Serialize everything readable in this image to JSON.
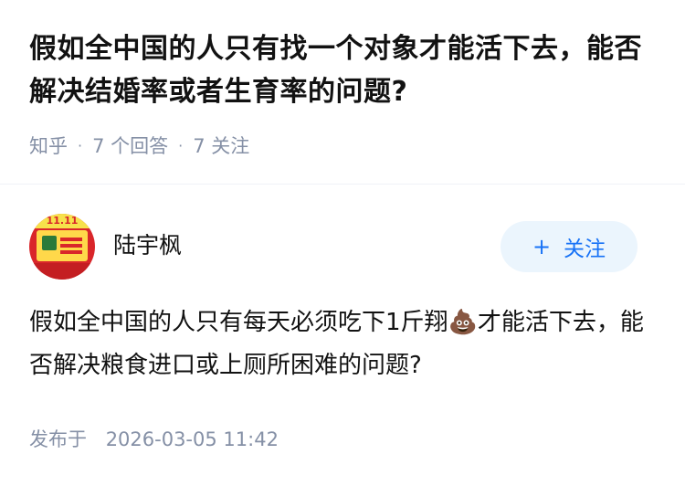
{
  "question": {
    "title": "假如全中国的人只有找一个对象才能活下去，能否解决结婚率或者生育率的问题?",
    "source": "知乎",
    "separator": "·",
    "answer_count": "7 个回答",
    "follow_count": "7 关注"
  },
  "author": {
    "avatar_text": "11.11",
    "name": "陆宇枫",
    "follow_plus": "+",
    "follow_label": "关注"
  },
  "answer": {
    "text_before": "假如全中国的人只有每天必须吃下1斤翔",
    "emoji": "💩",
    "text_after": "才能活下去，能否解决粮食进口或上厕所困难的问题?"
  },
  "publish": {
    "label": "发布于",
    "datetime": "2026-03-05 11:42"
  },
  "colors": {
    "title": "#121212",
    "meta": "#8590a6",
    "accent": "#1772f6",
    "follow_bg": "#ebf5fd"
  }
}
